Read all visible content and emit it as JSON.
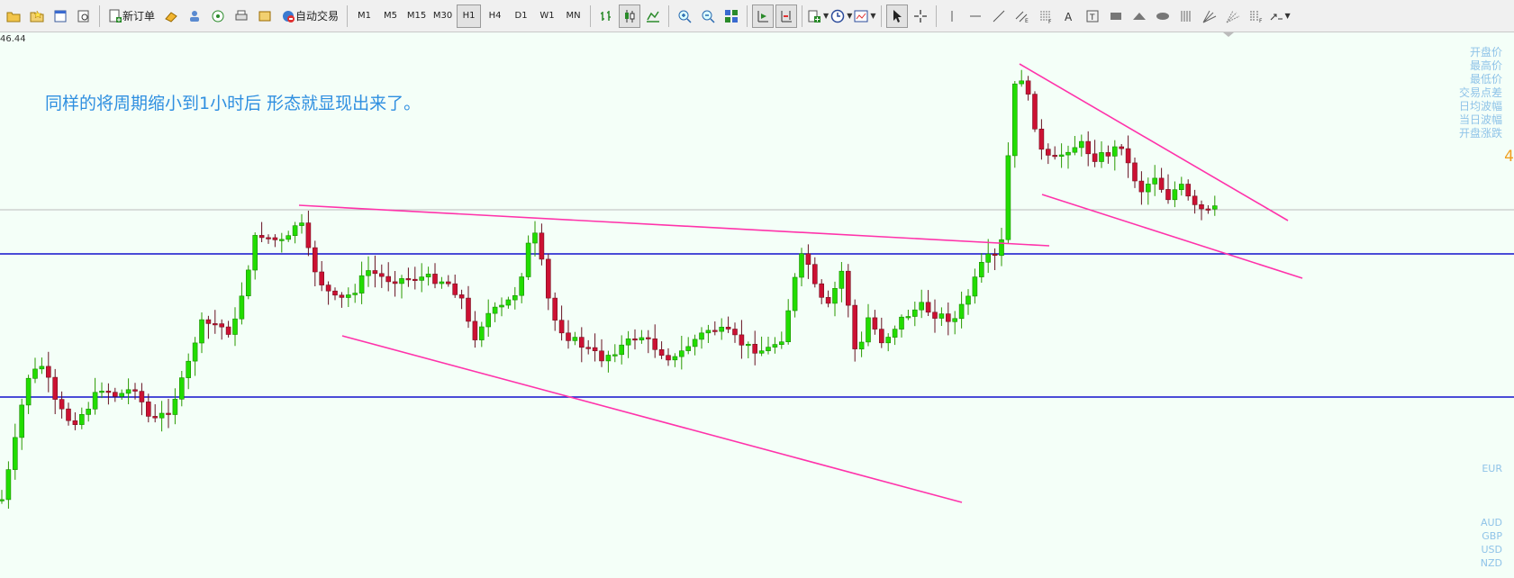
{
  "toolbar": {
    "new_order_label": "新订单",
    "auto_trade_label": "自动交易",
    "timeframes": [
      "M1",
      "M5",
      "M15",
      "M30",
      "H1",
      "H4",
      "D1",
      "W1",
      "MN"
    ],
    "active_timeframe": "H1"
  },
  "chart": {
    "price_label_top": "46.44",
    "annotation": "同样的将周期缩小到1小时后 形态就显现出来了。",
    "info_labels": [
      "开盘价",
      "最高价",
      "最低价",
      "交易点差",
      "日均波幅",
      "当日波幅",
      "开盘涨跌"
    ],
    "right_number": "4",
    "currencies": [
      "EUR",
      "",
      "",
      "",
      "AUD",
      "GBP",
      "USD",
      "NZD"
    ],
    "colors": {
      "bull": "#22dd00",
      "bear": "#cc1133",
      "trendline": "#ff33aa",
      "support": "#1111cc",
      "text": "#2f8fe0"
    }
  }
}
